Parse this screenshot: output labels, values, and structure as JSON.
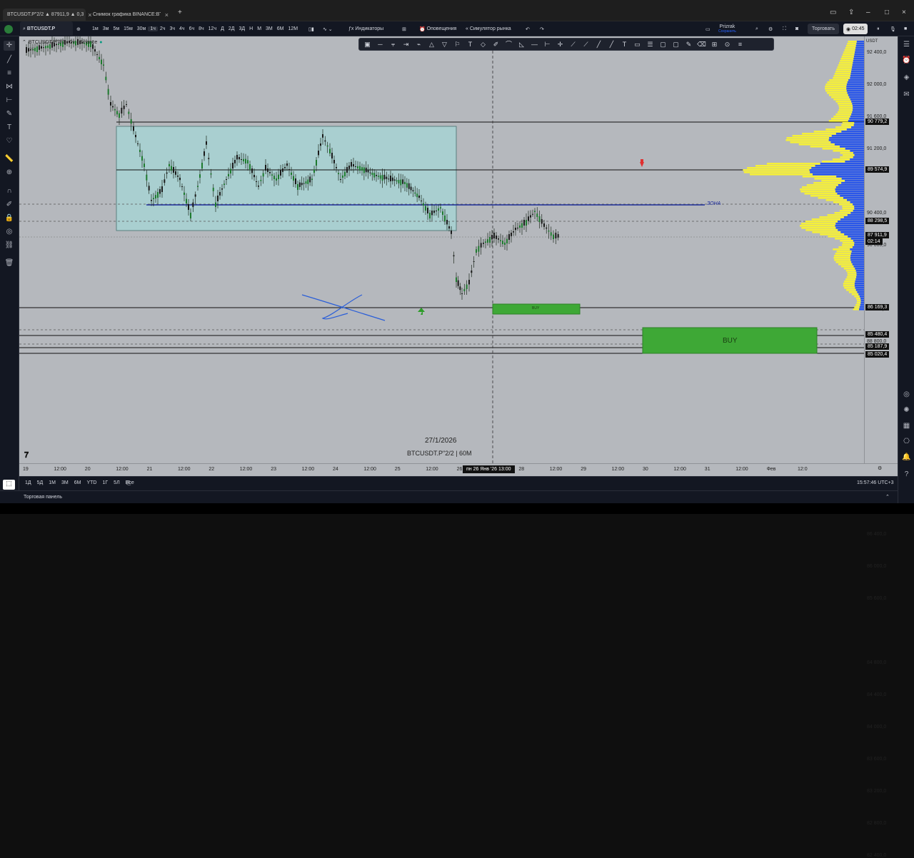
{
  "browser": {
    "tabs": [
      {
        "label": "BTCUSDT.P\"2/2 ▲ 87911,9 ▲ 0,3"
      },
      {
        "label": "Снимок графика BINANCE:BTCUSDT"
      }
    ],
    "new_tab": "+"
  },
  "toolbar": {
    "symbol": "BTCUSDT.P",
    "intervals": [
      "1м",
      "3м",
      "5м",
      "15м",
      "30м",
      "1ч",
      "2ч",
      "3ч",
      "4ч",
      "6ч",
      "8ч",
      "12ч",
      "Д",
      "2Д",
      "3Д",
      "Н",
      "М",
      "3М",
      "6М",
      "12М"
    ],
    "active_interval": "1ч",
    "indicators": "Индикаторы",
    "alerts": "Оповещения",
    "replay": "Симулятор рынка",
    "profile_name": "Prizrak",
    "profile_status": "Сохранить",
    "trade": "Торговать",
    "clock": "02:45"
  },
  "chart": {
    "legend": "BTCUSDT.P\"2/2 · 1ч · Binance",
    "legend_sub": "35",
    "zone_label": "ЗОНА",
    "buy_small": "BUY",
    "buy_big": "BUY",
    "watermark_date": "27/1/2026",
    "watermark_symbol": "BTCUSDT.P\"2/2 | 60M",
    "currency": "USDT"
  },
  "price_axis": {
    "labels": [
      "92 400,0",
      "92 000,0",
      "91 600,0",
      "91 200,0",
      "90 400,0",
      "90 000,0",
      "89 200,0",
      "88 800,0",
      "87 200,0",
      "86 800,0",
      "86 400,0",
      "86 000,0",
      "85 600,0",
      "84 800,0",
      "84 400,0",
      "84 000,0",
      "83 600,0",
      "83 200,0",
      "82 800,0",
      "82 400,0"
    ],
    "tags": [
      {
        "text": "90 779,2",
        "color": "#111111"
      },
      {
        "text": "89 574,9",
        "color": "#111111"
      },
      {
        "text": "88 298,5",
        "color": "#111111"
      },
      {
        "text": "87 911,9",
        "color": "#111111"
      },
      {
        "text": "02:14",
        "color": "#111111"
      },
      {
        "text": "86 169,3",
        "color": "#111111"
      },
      {
        "text": "85 480,4",
        "color": "#111111"
      },
      {
        "text": "85 187,9",
        "color": "#111111"
      },
      {
        "text": "85 020,4",
        "color": "#111111"
      }
    ]
  },
  "time_axis": {
    "labels": [
      "19",
      "12:00",
      "20",
      "12:00",
      "21",
      "12:00",
      "22",
      "12:00",
      "23",
      "12:00",
      "24",
      "12:00",
      "25",
      "12:00",
      "26",
      "12:00",
      "28",
      "12:00",
      "29",
      "12:00",
      "30",
      "12:00",
      "31",
      "12:00",
      "Фев",
      "12:0"
    ],
    "cursor": "пн 26 Янв '26   13:00"
  },
  "bottom": {
    "ranges": [
      "1Д",
      "5Д",
      "1М",
      "3М",
      "6М",
      "YTD",
      "1Г",
      "5Л",
      "Все"
    ],
    "time": "15:57:46 UTC+3"
  },
  "panel": {
    "label": "Торговая панель"
  },
  "colors": {
    "bg": "#b5b8bd",
    "box": "#a9cfd0",
    "buy": "#3ea836",
    "zone": "#1a2a9c",
    "vp_yellow": "#f5ef3a",
    "vp_blue": "#2b57e8"
  }
}
